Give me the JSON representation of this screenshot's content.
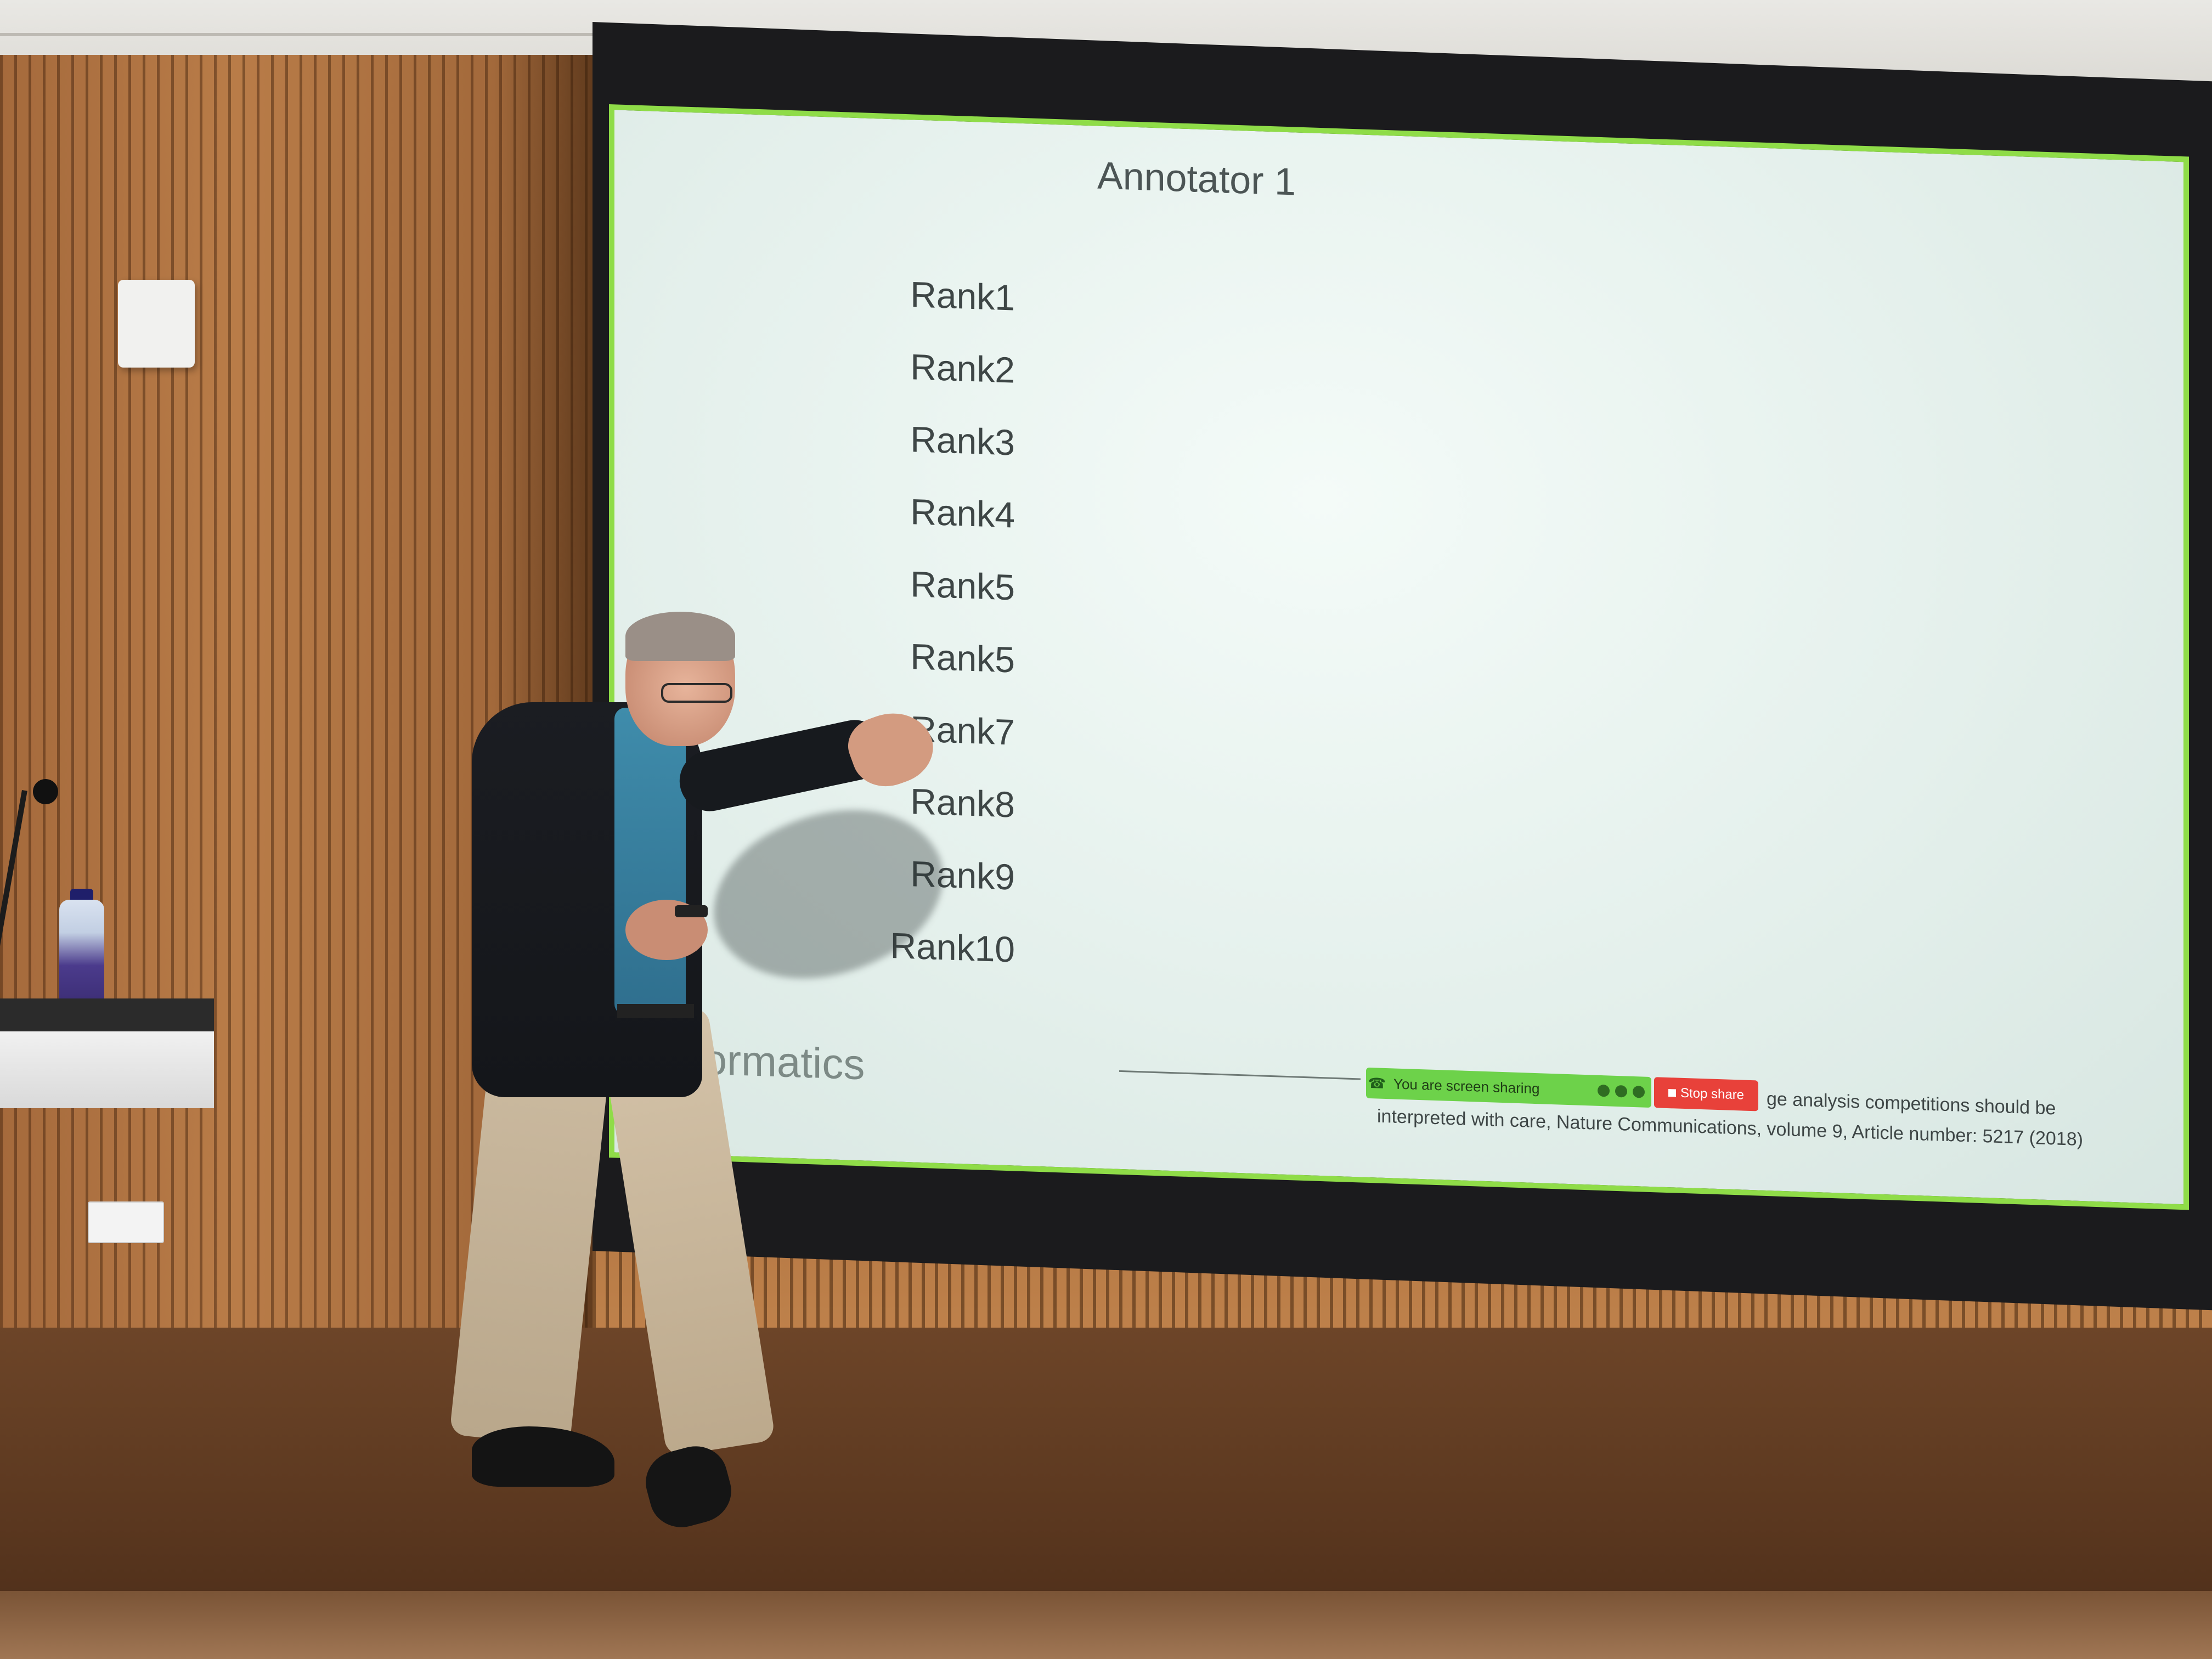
{
  "slide": {
    "title": "Annotator 1",
    "ranks": [
      "Rank1",
      "Rank2",
      "Rank3",
      "Rank4",
      "Rank5",
      "Rank5",
      "Rank7",
      "Rank8",
      "Rank9",
      "Rank10"
    ],
    "footer_brand": "formatics",
    "citation_lead": "ge analysis competitions should be",
    "citation": "interpreted with care, Nature Communications, volume 9, Article number: 5217 (2018)"
  },
  "share_toolbar": {
    "status_text": "You are screen sharing",
    "stop_label": "Stop share",
    "phone_icon": "phone-icon",
    "stop_icon": "stop-icon"
  },
  "colors": {
    "screen_border": "#8fdc48",
    "share_bar": "#6dd24a",
    "stop_button": "#e8413a"
  }
}
